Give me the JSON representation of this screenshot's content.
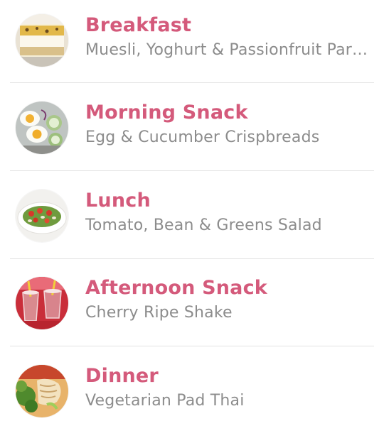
{
  "meals": [
    {
      "title": "Breakfast",
      "description": "Muesli, Yoghurt & Passionfruit Parfait",
      "image": "muesli-parfait-photo"
    },
    {
      "title": "Morning Snack",
      "description": "Egg & Cucumber Crispbreads",
      "image": "egg-cucumber-photo"
    },
    {
      "title": "Lunch",
      "description": "Tomato, Bean & Greens Salad",
      "image": "tomato-salad-photo"
    },
    {
      "title": "Afternoon Snack",
      "description": "Cherry Ripe Shake",
      "image": "cherry-shake-photo"
    },
    {
      "title": "Dinner",
      "description": "Vegetarian Pad Thai",
      "image": "pad-thai-photo"
    }
  ],
  "colors": {
    "title": "#d45a7b",
    "description": "#8c8c8c",
    "divider": "#e3e3e3",
    "background": "#ffffff"
  }
}
